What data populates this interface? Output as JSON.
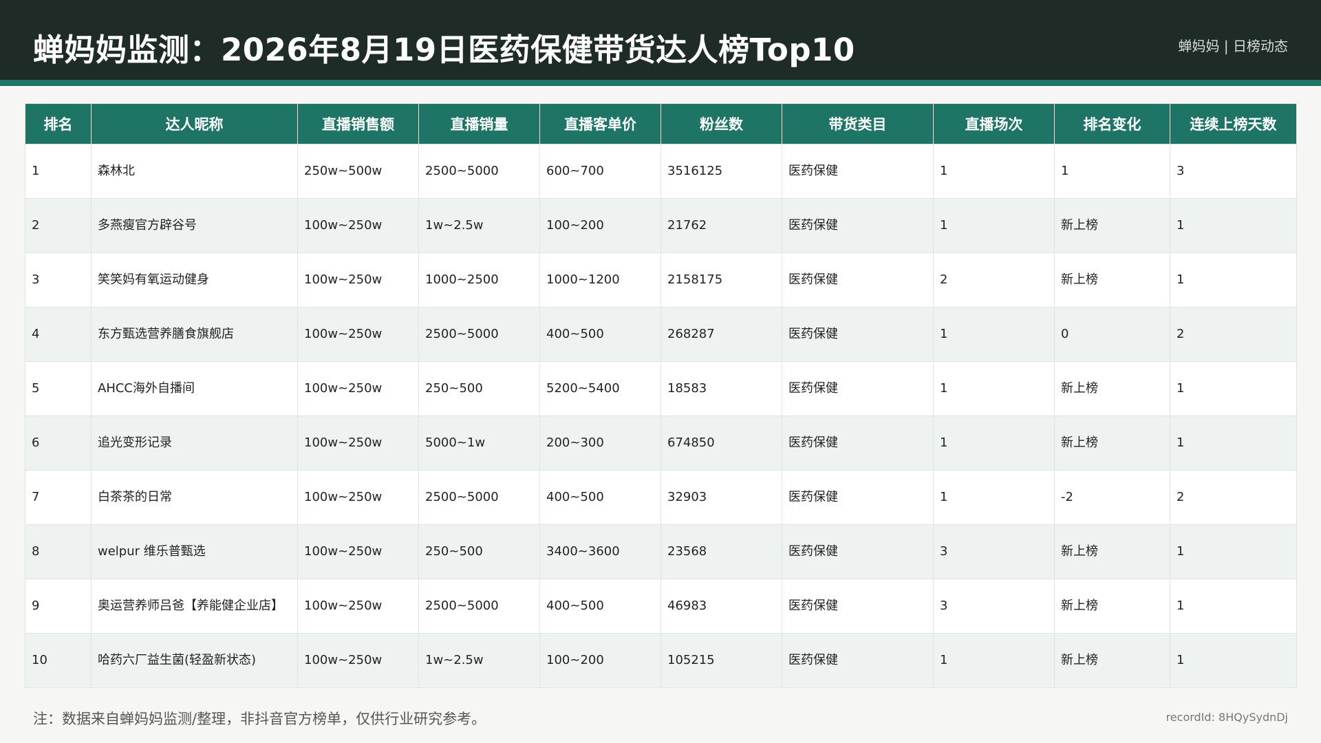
{
  "header": {
    "title": "蝉妈妈监测：2026年8月19日医药保健带货达人榜Top10",
    "brand": "蝉妈妈 | 日榜动态"
  },
  "table": {
    "columns": [
      "排名",
      "达人昵称",
      "直播销售额",
      "直播销量",
      "直播客单价",
      "粉丝数",
      "带货类目",
      "直播场次",
      "排名变化",
      "连续上榜天数"
    ],
    "rows": [
      [
        "1",
        "森林北",
        "250w~500w",
        "2500~5000",
        "600~700",
        "3516125",
        "医药保健",
        "1",
        "1",
        "3"
      ],
      [
        "2",
        "多燕瘦官方辟谷号",
        "100w~250w",
        "1w~2.5w",
        "100~200",
        "21762",
        "医药保健",
        "1",
        "新上榜",
        "1"
      ],
      [
        "3",
        "笑笑妈有氧运动健身",
        "100w~250w",
        "1000~2500",
        "1000~1200",
        "2158175",
        "医药保健",
        "2",
        "新上榜",
        "1"
      ],
      [
        "4",
        "东方甄选营养膳食旗舰店",
        "100w~250w",
        "2500~5000",
        "400~500",
        "268287",
        "医药保健",
        "1",
        "0",
        "2"
      ],
      [
        "5",
        "AHCC海外自播间",
        "100w~250w",
        "250~500",
        "5200~5400",
        "18583",
        "医药保健",
        "1",
        "新上榜",
        "1"
      ],
      [
        "6",
        "追光变形记录",
        "100w~250w",
        "5000~1w",
        "200~300",
        "674850",
        "医药保健",
        "1",
        "新上榜",
        "1"
      ],
      [
        "7",
        "白茶茶的日常",
        "100w~250w",
        "2500~5000",
        "400~500",
        "32903",
        "医药保健",
        "1",
        "-2",
        "2"
      ],
      [
        "8",
        "welpur 维乐普甄选",
        "100w~250w",
        "250~500",
        "3400~3600",
        "23568",
        "医药保健",
        "3",
        "新上榜",
        "1"
      ],
      [
        "9",
        "奥运营养师吕爸【养能健企业店】",
        "100w~250w",
        "2500~5000",
        "400~500",
        "46983",
        "医药保健",
        "3",
        "新上榜",
        "1"
      ],
      [
        "10",
        "哈药六厂益生菌(轻盈新状态)",
        "100w~250w",
        "1w~2.5w",
        "100~200",
        "105215",
        "医药保健",
        "1",
        "新上榜",
        "1"
      ]
    ]
  },
  "footer": {
    "note": "注：数据来自蝉妈妈监测/整理，非抖音官方榜单，仅供行业研究参考。",
    "record_id": "recordId: 8HQySydnDj"
  },
  "colors": {
    "header_bg": "#1f2b27",
    "accent": "#1e7566",
    "stripe_row": "#eef3f1"
  }
}
